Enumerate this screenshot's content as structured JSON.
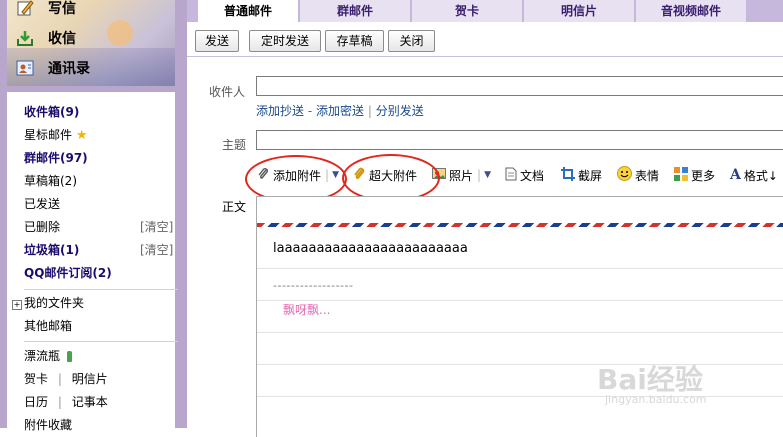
{
  "sidebar": {
    "top_items": [
      {
        "label": "写信",
        "icon": "write-icon"
      },
      {
        "label": "收信",
        "icon": "inbox-download-icon"
      },
      {
        "label": "通讯录",
        "icon": "contacts-icon"
      }
    ],
    "folders": [
      {
        "label": "收件箱(9)"
      },
      {
        "label": "星标邮件"
      },
      {
        "label": "群邮件(97)"
      },
      {
        "label": "草稿箱(2)"
      },
      {
        "label": "已发送"
      },
      {
        "label": "已删除",
        "action": "[清空]"
      },
      {
        "label": "垃圾箱(1)",
        "action": "[清空]"
      },
      {
        "label": "QQ邮件订阅(2)"
      }
    ],
    "my_folders": "我的文件夹",
    "other_mailboxes": "其他邮箱",
    "drift_bottle": "漂流瓶",
    "greeting_card": "贺卡",
    "postcard": "明信片",
    "calendar": "日历",
    "notepad": "记事本",
    "favorites": "附件收藏"
  },
  "tabs": [
    "普通邮件",
    "群邮件",
    "贺卡",
    "明信片",
    "音视频邮件"
  ],
  "toolbar": {
    "send": "发送",
    "scheduled_send": "定时发送",
    "save_draft": "存草稿",
    "close": "关闭"
  },
  "compose": {
    "to_label": "收件人",
    "cc_link": "添加抄送",
    "bcc_link": "添加密送",
    "separate_send_link": "分别发送",
    "link_sep": "-",
    "pipe": "|",
    "subject_label": "主题",
    "attach": "添加附件",
    "large_attach": "超大附件",
    "photo": "照片",
    "document": "文档",
    "screenshot": "截屏",
    "emoji": "表情",
    "more": "更多",
    "format": "格式↓",
    "body_label": "正文",
    "body_text": "laaaaaaaaaaaaaaaaaaaaaaaa",
    "signature_line": "------------------",
    "signature_name": "飘呀飘..."
  },
  "watermark": {
    "brand": "Bai经验",
    "url": "jingyan.baidu.com"
  },
  "colors": {
    "accent": "#3a1f6e",
    "annotation": "#e2261c",
    "sidebar_bg": "#b8a6cd",
    "main_bg": "#c6b8dc",
    "signature": "#e36bb6"
  }
}
